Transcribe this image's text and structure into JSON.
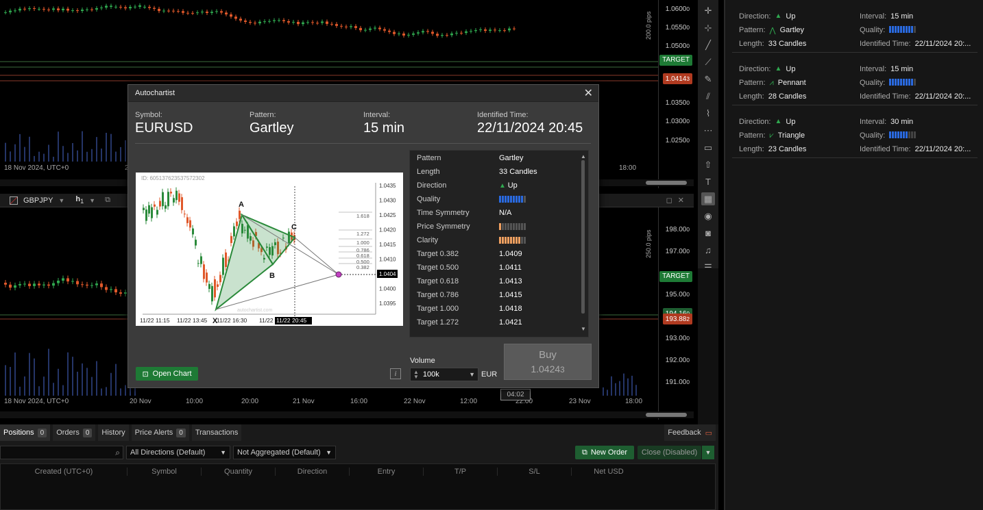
{
  "chart1": {
    "time_start": "18 Nov 2024, UTC+0",
    "time_label_2": "2",
    "time_label_right": "18:00",
    "pips": "200.0 pips",
    "prices": [
      "1.0600",
      "1.0550",
      "1.0500",
      "1.0350",
      "1.0300",
      "1.0250"
    ],
    "price_suffixes": [
      "0",
      "0",
      "0",
      "0",
      "0",
      "0"
    ],
    "target_label": "TARGET",
    "current_price": "1.0414",
    "current_price_suffix": "3"
  },
  "chart2": {
    "symbol": "GBPJPY",
    "timeframe": "h",
    "timeframe_sub": "1",
    "time_labels": [
      "18 Nov 2024, UTC+0",
      "20 Nov",
      "10:00",
      "20:00",
      "21 Nov",
      "16:00",
      "22 Nov",
      "12:00",
      "22:00",
      "23 Nov",
      "18:00"
    ],
    "pips": "250.0 pips",
    "prices": [
      "198.00",
      "197.00",
      "195.00",
      "193.00",
      "192.00",
      "191.00"
    ],
    "price_suffixes": [
      "0",
      "0",
      "0",
      "0",
      "0",
      "0"
    ],
    "target_label": "TARGET",
    "price_a": "194.16",
    "price_a_suffix": "0",
    "current_price": "193.88",
    "current_price_suffix": "2",
    "hover_time": "04:02"
  },
  "side_patterns": [
    {
      "direction_label": "Direction:",
      "direction": "Up",
      "pattern_label": "Pattern:",
      "pattern": "Gartley",
      "length_label": "Length:",
      "length": "33 Candles",
      "interval_label": "Interval:",
      "interval": "15 min",
      "quality_label": "Quality:",
      "quality": 9,
      "identified_label": "Identified Time:",
      "identified": "22/11/2024 20:..."
    },
    {
      "direction_label": "Direction:",
      "direction": "Up",
      "pattern_label": "Pattern:",
      "pattern": "Pennant",
      "length_label": "Length:",
      "length": "28 Candles",
      "interval_label": "Interval:",
      "interval": "15 min",
      "quality_label": "Quality:",
      "quality": 9,
      "identified_label": "Identified Time:",
      "identified": "22/11/2024 20:..."
    },
    {
      "direction_label": "Direction:",
      "direction": "Up",
      "pattern_label": "Pattern:",
      "pattern": "Triangle",
      "length_label": "Length:",
      "length": "23 Candles",
      "interval_label": "Interval:",
      "interval": "30 min",
      "quality_label": "Quality:",
      "quality": 7,
      "identified_label": "Identified Time:",
      "identified": "22/11/2024 20:..."
    }
  ],
  "bottom": {
    "tabs": [
      {
        "label": "Positions",
        "count": "0"
      },
      {
        "label": "Orders",
        "count": "0"
      },
      {
        "label": "History",
        "count": ""
      },
      {
        "label": "Price Alerts",
        "count": "0"
      },
      {
        "label": "Transactions",
        "count": ""
      }
    ],
    "feedback": "Feedback",
    "direction_filter": "All Directions (Default)",
    "aggregate_filter": "Not Aggregated (Default)",
    "new_order": "New Order",
    "close_btn": "Close (Disabled)",
    "columns": [
      "Created (UTC+0)",
      "Symbol",
      "Quantity",
      "Direction",
      "Entry",
      "T/P",
      "S/L",
      "Net USD"
    ]
  },
  "modal": {
    "title": "Autochartist",
    "symbol_label": "Symbol:",
    "symbol": "EURUSD",
    "pattern_label": "Pattern:",
    "pattern": "Gartley",
    "interval_label": "Interval:",
    "interval": "15 min",
    "identified_label": "Identified Time:",
    "identified": "22/11/2024 20:45",
    "preview": {
      "id_text": "ID: 605137623537572302",
      "prices": [
        "1.0435",
        "1.0430",
        "1.0425",
        "1.0420",
        "1.0415",
        "1.0410",
        "1.0405",
        "1.0400",
        "1.0395"
      ],
      "current": "1.0404",
      "fibs": [
        "1.618",
        "1.272",
        "1.000",
        "0.786",
        "0.618",
        "0.500",
        "0.382"
      ],
      "points": [
        "A",
        "B",
        "C",
        "X"
      ],
      "times": [
        "11/22 11:15",
        "11/22 13:45",
        "11/22 16:30",
        "11/22",
        "11/22 20:45"
      ],
      "watermark": "autochartist.com"
    },
    "details": [
      {
        "k": "Pattern",
        "v": "Gartley"
      },
      {
        "k": "Length",
        "v": "33 Candles"
      },
      {
        "k": "Direction",
        "v": "Up"
      },
      {
        "k": "Quality",
        "v": ""
      },
      {
        "k": "Time Symmetry",
        "v": "N/A"
      },
      {
        "k": "Price Symmetry",
        "v": ""
      },
      {
        "k": "Clarity",
        "v": ""
      },
      {
        "k": "Target 0.382",
        "v": "1.0409"
      },
      {
        "k": "Target 0.500",
        "v": "1.0411"
      },
      {
        "k": "Target 0.618",
        "v": "1.0413"
      },
      {
        "k": "Target 0.786",
        "v": "1.0415"
      },
      {
        "k": "Target 1.000",
        "v": "1.0418"
      },
      {
        "k": "Target 1.272",
        "v": "1.0421"
      }
    ],
    "quality_level": 9,
    "price_symmetry_level": 1,
    "clarity_level": 8,
    "open_chart": "Open Chart",
    "info": "i",
    "volume_label": "Volume",
    "volume": "100k",
    "volume_currency": "EUR",
    "buy_label": "Buy",
    "buy_price": "1.0424",
    "buy_price_suffix": "3",
    "colors": {
      "up": "#2fa84f",
      "down": "#e0582a",
      "quality": "#2a6ae0",
      "clarity": "#f0a060"
    }
  }
}
